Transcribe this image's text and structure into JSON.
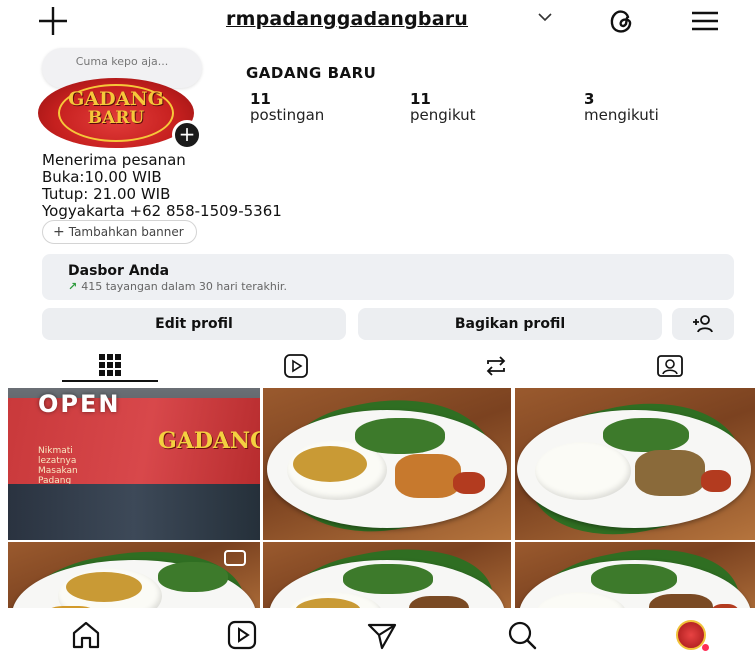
{
  "header": {
    "username": "rmpadanggadangbaru",
    "chevron": "﹀",
    "icons": [
      "plus-icon",
      "threads-icon",
      "menu-icon"
    ]
  },
  "note": {
    "text": "Cuma kepo aja..."
  },
  "profile": {
    "avatar_line1": "GADANG",
    "avatar_line2": "BARU",
    "display_name": "GADANG BARU",
    "stats": [
      {
        "value": "11",
        "label": "postingan"
      },
      {
        "value": "11",
        "label": "pengikut"
      },
      {
        "value": "3",
        "label": "mengikuti"
      }
    ],
    "bio": [
      "Menerima pesanan",
      "Buka:10.00 WIB",
      "Tutup: 21.00 WIB",
      "Yogyakarta +62 858-1509-5361"
    ]
  },
  "banner": {
    "label": "Tambahkan banner"
  },
  "dashboard": {
    "title": "Dasbor Anda",
    "subtitle": "415 tayangan dalam 30 hari terakhir."
  },
  "buttons": {
    "edit": "Edit profil",
    "share": "Bagikan profil"
  },
  "tabs": [
    "grid-icon",
    "reels-icon",
    "reposts-icon",
    "tagged-icon"
  ],
  "grid": {
    "post1_sign": "OPEN",
    "post1_banner": "GADANG",
    "post1_caption": "Nikmati lezatnya Masakan Padang"
  },
  "colors": {
    "accent_red": "#c6201f",
    "gold": "#f6c73a",
    "button_bg": "#eceef1",
    "trend_green": "#2e9b3e"
  },
  "bottom_nav": [
    "home-icon",
    "reels-icon",
    "send-icon",
    "search-icon",
    "profile-avatar"
  ]
}
